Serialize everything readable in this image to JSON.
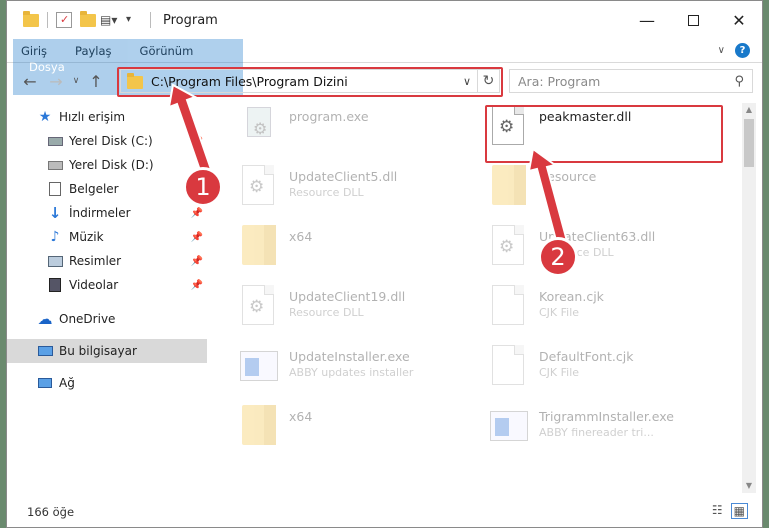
{
  "window": {
    "title": "Program"
  },
  "ribbon": {
    "tabs": [
      "Dosya",
      "Giriş",
      "Paylaş",
      "Görünüm"
    ]
  },
  "address": {
    "path": "C:\\Program Files\\Program Dizini"
  },
  "search": {
    "placeholder": "Ara: Program"
  },
  "sidebar": {
    "items": [
      {
        "label": "Hızlı erişim",
        "icon": "star-icon"
      },
      {
        "label": "Yerel Disk (C:)",
        "icon": "drive-icon"
      },
      {
        "label": "Yerel Disk (D:)",
        "icon": "drive-icon"
      },
      {
        "label": "Belgeler",
        "icon": "documents-icon"
      },
      {
        "label": "İndirmeler",
        "icon": "download-icon"
      },
      {
        "label": "Müzik",
        "icon": "music-icon"
      },
      {
        "label": "Resimler",
        "icon": "pictures-icon"
      },
      {
        "label": "Videolar",
        "icon": "videos-icon"
      },
      {
        "label": "OneDrive",
        "icon": "cloud-icon"
      },
      {
        "label": "Bu bilgisayar",
        "icon": "computer-icon"
      },
      {
        "label": "Ağ",
        "icon": "network-icon"
      }
    ]
  },
  "files": [
    {
      "name": "program.exe",
      "desc": "",
      "type": "exe-gear"
    },
    {
      "name": "peakmaster.dll",
      "desc": "",
      "type": "dll"
    },
    {
      "name": "UpdateClient5.dll",
      "desc": "Resource DLL",
      "type": "dll"
    },
    {
      "name": "Resource",
      "desc": "",
      "type": "folder"
    },
    {
      "name": "x64",
      "desc": "",
      "type": "folder"
    },
    {
      "name": "UpdateClient63.dll",
      "desc": "Resource DLL",
      "type": "dll"
    },
    {
      "name": "UpdateClient19.dll",
      "desc": "Resource DLL",
      "type": "dll"
    },
    {
      "name": "Korean.cjk",
      "desc": "CJK File",
      "type": "doc"
    },
    {
      "name": "UpdateInstaller.exe",
      "desc": "ABBY updates installer",
      "type": "exe"
    },
    {
      "name": "DefaultFont.cjk",
      "desc": "CJK File",
      "type": "doc"
    },
    {
      "name": "x64",
      "desc": "",
      "type": "folder"
    },
    {
      "name": "TrigrammInstaller.exe",
      "desc": "ABBY finereader tri...",
      "type": "exe"
    }
  ],
  "status": {
    "count": "166 öğe"
  },
  "callouts": {
    "one": "1",
    "two": "2"
  },
  "colors": {
    "accent": "#1979ca",
    "highlight": "#d9393f"
  }
}
